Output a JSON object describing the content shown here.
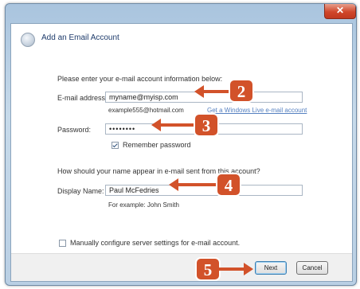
{
  "window": {
    "close_glyph": "✕",
    "back_icon": "back-arrow-icon",
    "title": "Add an Email Account"
  },
  "form": {
    "intro": "Please enter your e-mail account information below:",
    "email_label": "E-mail address:",
    "email_value": "myname@myisp.com",
    "email_example": "example555@hotmail.com",
    "email_link": "Get a Windows Live e-mail account",
    "password_label": "Password:",
    "password_value": "••••••••",
    "remember_label": "Remember password",
    "remember_checked": true,
    "display_question": "How should your name appear in e-mail sent from this account?",
    "display_label": "Display Name:",
    "display_value": "Paul McFedries",
    "display_example": "For example: John Smith",
    "manual_label": "Manually configure server settings for e-mail account.",
    "manual_checked": false
  },
  "buttons": {
    "next": "Next",
    "cancel": "Cancel"
  },
  "callouts": {
    "step2": "2",
    "step3": "3",
    "step4": "4",
    "step5": "5",
    "color": "#d2522a"
  }
}
